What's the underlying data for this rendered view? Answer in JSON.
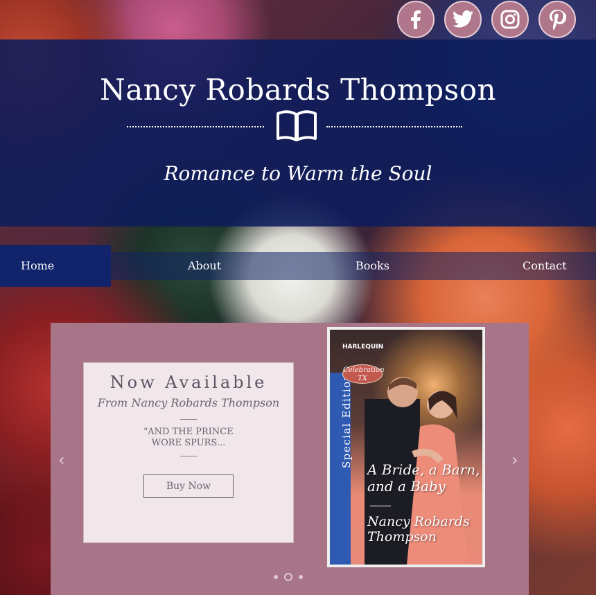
{
  "social": {
    "links": [
      {
        "icon": "facebook-icon",
        "glyph": "f"
      },
      {
        "icon": "twitter-icon",
        "glyph": ""
      },
      {
        "icon": "instagram-icon",
        "glyph": ""
      },
      {
        "icon": "pinterest-icon",
        "glyph": "P"
      }
    ]
  },
  "header": {
    "title": "Nancy Robards Thompson",
    "tagline": "Romance to Warm the Soul"
  },
  "nav": {
    "items": [
      "Home",
      "About",
      "Books",
      "Contact"
    ],
    "active": "Home"
  },
  "slide": {
    "headline": "Now Available",
    "byline": "From Nancy Robards Thompson",
    "quote_line1": "\"AND THE PRINCE",
    "quote_line2": "WORE SPURS...",
    "button": "Buy Now"
  },
  "cover": {
    "publisher": "HARLEQUIN",
    "series_line1": "Celebration",
    "series_line2": "TX",
    "spine": "Special Edition",
    "title_line1": "A Bride, a Barn,",
    "title_line2": "and a Baby",
    "author_line1": "Nancy Robards",
    "author_line2": "Thompson"
  },
  "controls": {
    "prev": "‹",
    "next": "›",
    "dot_count": 3,
    "active_dot": 2
  },
  "colors": {
    "header_band": "#0c1c5c",
    "nav_active": "#10236b",
    "slide_bg": "#a87488",
    "card_bg": "#f1e6ea",
    "social_circle": "#b0778c"
  }
}
